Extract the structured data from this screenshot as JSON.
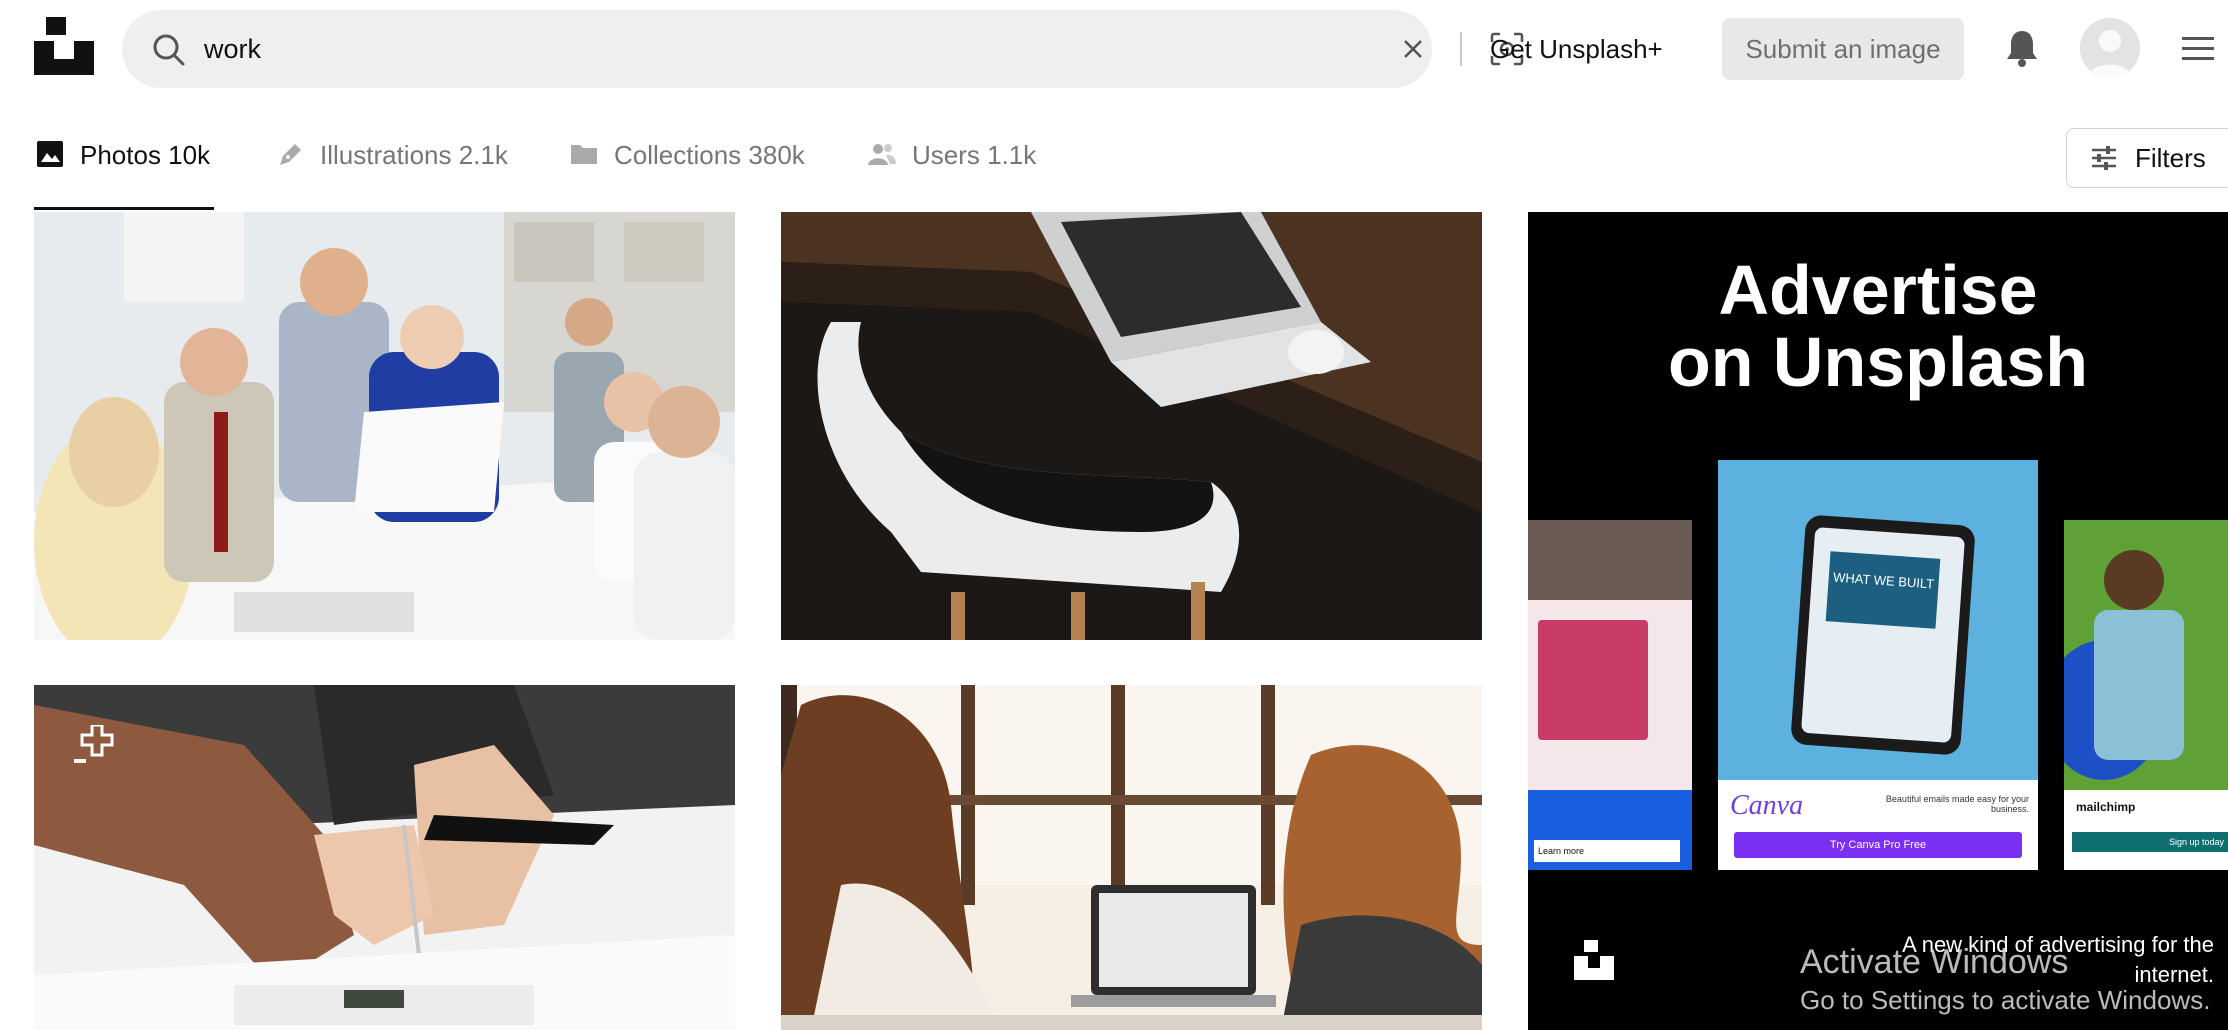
{
  "header": {
    "search_value": "work",
    "get_plus_label": "Get Unsplash+",
    "submit_label": "Submit an image"
  },
  "tabs": [
    {
      "label": "Photos 10k",
      "icon": "photo-icon",
      "active": true
    },
    {
      "label": "Illustrations 2.1k",
      "icon": "pen-icon",
      "active": false
    },
    {
      "label": "Collections 380k",
      "icon": "folder-icon",
      "active": false
    },
    {
      "label": "Users 1.1k",
      "icon": "users-icon",
      "active": false
    }
  ],
  "filters_label": "Filters",
  "photos": [
    {
      "subject": "business-meeting",
      "colors": [
        "#e9ecef",
        "#2b3a67"
      ]
    },
    {
      "subject": "laptop-on-desk-with-chair",
      "colors": [
        "#1a1613",
        "#5a3b26"
      ]
    },
    {
      "subject": "handshake-and-tablet",
      "colors": [
        "#f3f3f3",
        "#3a3a3a"
      ]
    },
    {
      "subject": "two-women-at-laptop",
      "colors": [
        "#f7efe6",
        "#7a4b2f"
      ]
    }
  ],
  "ad": {
    "title_line1": "Advertise",
    "title_line2": "on Unsplash",
    "tagline": "A new kind of advertising for the internet.",
    "card_brand_1": "Canva",
    "card_brand_1_cta": "Try Canva Pro Free",
    "card_brand_2": "mailchimp",
    "card_left_cta": "Learn more",
    "card_right_cta": "Sign up today",
    "card_small_text": "Beautiful emails made easy for your business.",
    "tablet_text": "WHAT WE BUILT"
  },
  "os_overlay": {
    "line1": "Activate Windows",
    "line2": "Go to Settings to activate Windows."
  }
}
